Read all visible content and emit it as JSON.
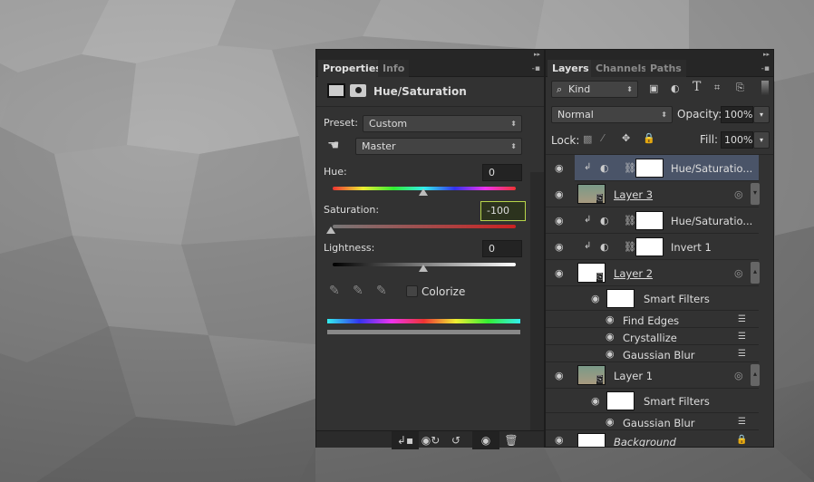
{
  "properties": {
    "tabs": [
      "Properties",
      "Info"
    ],
    "title": "Hue/Saturation",
    "preset_label": "Preset:",
    "preset_value": "Custom",
    "channel_value": "Master",
    "hue_label": "Hue:",
    "hue_value": "0",
    "saturation_label": "Saturation:",
    "saturation_value": "-100",
    "lightness_label": "Lightness:",
    "lightness_value": "0",
    "colorize_label": "Colorize",
    "colorize_checked": false,
    "accent_color": "#b8d64a"
  },
  "layers": {
    "tabs": [
      "Layers",
      "Channels",
      "Paths"
    ],
    "filter_kind": "Kind",
    "blend_mode": "Normal",
    "opacity_label": "Opacity:",
    "opacity_value": "100%",
    "lock_label": "Lock:",
    "fill_label": "Fill:",
    "fill_value": "100%",
    "rows": [
      {
        "name": "Hue/Saturatio...",
        "type": "adjustment",
        "selected": true
      },
      {
        "name": "Layer 3",
        "type": "smart"
      },
      {
        "name": "Hue/Saturatio...",
        "type": "adjustment"
      },
      {
        "name": "Invert 1",
        "type": "adjustment"
      },
      {
        "name": "Layer 2",
        "type": "smart"
      },
      {
        "name": "Smart Filters",
        "type": "smartfilters"
      },
      {
        "name": "Find Edges",
        "type": "filter"
      },
      {
        "name": "Crystallize",
        "type": "filter"
      },
      {
        "name": "Gaussian Blur",
        "type": "filter"
      },
      {
        "name": "Layer 1",
        "type": "smart"
      },
      {
        "name": "Smart Filters",
        "type": "smartfilters"
      },
      {
        "name": "Gaussian Blur",
        "type": "filter"
      },
      {
        "name": "Background",
        "type": "background"
      }
    ],
    "selected_color": "#4a5468"
  }
}
